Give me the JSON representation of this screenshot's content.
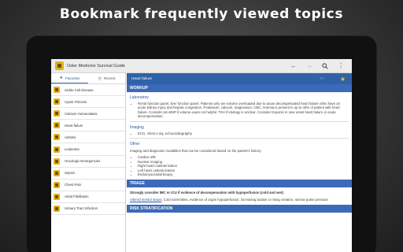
{
  "headline": "Bookmark frequently viewed topics",
  "app": {
    "title": "Osler Medicine Survival Guide",
    "icons": [
      "back-arrow-icon",
      "forward-arrow-icon",
      "search-icon",
      "overflow-menu-icon"
    ]
  },
  "tabs": [
    {
      "label": "Favorites",
      "icon": "star-icon",
      "active": true
    },
    {
      "label": "Recent",
      "icon": "clock-icon",
      "active": false
    }
  ],
  "topics": [
    "Sickle Cell Disease",
    "Cystic Fibrosis",
    "Calcium Homeostasis",
    "Heart failure",
    "Arthritis",
    "Leukemia",
    "Oncologic Emergencies",
    "Sepsis",
    "Chest Pain",
    "Atrial Fibrillation",
    "Urinary Tract Infection"
  ],
  "detail": {
    "title": "Heart failure",
    "workup_header": "WORKUP",
    "lab_heading": "Laboratory",
    "lab_text": "Renal function panel, liver function panel: Patients who are volume overloaded due to acute decompensated heart failure often have an acute kidney injury and hepatic congestion. Potassium, calcium, magnesium. CBC: Anemia is present in up to 40% of patient with heart failure. Consider pro-BNP if volume exam not helpful. TSH if etiology is unclear. Consider troponin in new onset heart failure or acute decompensation.",
    "imaging_heading": "Imaging",
    "imaging_item": "ECG, chest x-ray, echocardiography",
    "other_heading": "Other",
    "other_text": "Imaging and diagnostic modalities that can be considered based on the patient's history:",
    "other_items": [
      "Cardiac MR",
      "Nuclear imaging",
      "Right heart catheterization",
      "Left heart catheterization",
      "Endomyocardial biopsy"
    ],
    "triage_header": "TRIAGE",
    "triage_bold": "Strongly consider IMC or ICU if evidence of decompensation with hypoperfusion (cold and wet):",
    "triage_link": "Altered mental status",
    "triage_rest": ", Cold extremities, evidence of organ hypoperfusion: increasing lactate or rising creatine, narrow pulse pressure",
    "risk_header": "RISK STRATIFICATION"
  },
  "colors": {
    "accent": "#3b6ab8",
    "header": "#2f62a8",
    "star": "#f3c324",
    "app_icon": "#e0b01c"
  }
}
